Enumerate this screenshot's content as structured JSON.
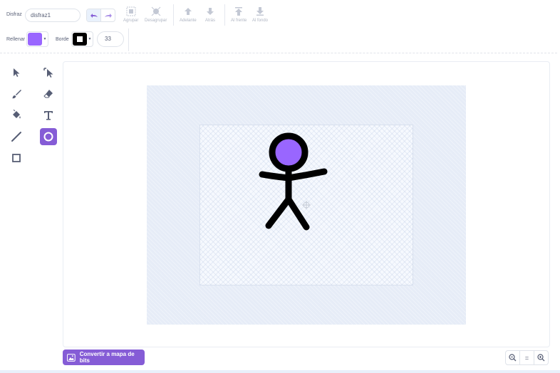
{
  "toolbar": {
    "costume_label": "Disfraz",
    "costume_name": "disfraz1",
    "group_label": "Agrupar",
    "ungroup_label": "Desagrupar",
    "forward_label": "Adelante",
    "backward_label": "Atrás",
    "front_label": "Al frente",
    "back_label": "Al fondo"
  },
  "style": {
    "fill_label": "Rellenar",
    "fill_color": "#9966ff",
    "outline_label": "Borde",
    "outline_color": "#000000",
    "outline_width": "33"
  },
  "canvas": {
    "convert_button_label": "Convertir a mapa de bits",
    "zoom_reset_label": "="
  },
  "colors": {
    "accent": "#855cd6",
    "icon": "#575e75"
  }
}
